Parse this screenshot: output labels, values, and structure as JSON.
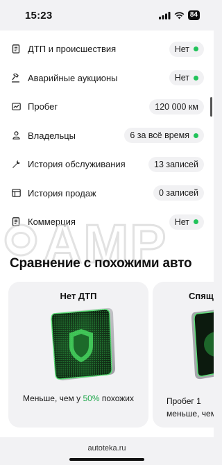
{
  "status_bar": {
    "time": "15:23",
    "battery": "84"
  },
  "rows": [
    {
      "icon": "document-icon",
      "label": "ДТП и происшествия",
      "value": "Нет",
      "dot": true
    },
    {
      "icon": "gavel-icon",
      "label": "Аварийные аукционы",
      "value": "Нет",
      "dot": true
    },
    {
      "icon": "odometer-icon",
      "label": "Пробег",
      "value": "120 000 км",
      "dot": false
    },
    {
      "icon": "person-icon",
      "label": "Владельцы",
      "value": "6 за всё время",
      "dot": true
    },
    {
      "icon": "wrench-icon",
      "label": "История обслуживания",
      "value": "13 записей",
      "dot": false
    },
    {
      "icon": "calendar-icon",
      "label": "История продаж",
      "value": "0 записей",
      "dot": false
    },
    {
      "icon": "document-icon",
      "label": "Коммерция",
      "value": "Нет",
      "dot": true
    }
  ],
  "watermark_text": "AMP",
  "section_title": "Сравнение с похожими авто",
  "cards": [
    {
      "title": "Нет ДТП",
      "caption_prefix": "Меньше, чем у ",
      "caption_percent": "50%",
      "caption_suffix": " похожих"
    },
    {
      "title": "Спящ",
      "caption_line1": "Пробег 1",
      "caption_line2": "меньше, чем у"
    }
  ],
  "footer": {
    "url": "autoteka.ru"
  },
  "colors": {
    "accent_green": "#21c35a",
    "text_green": "#21a84d"
  }
}
